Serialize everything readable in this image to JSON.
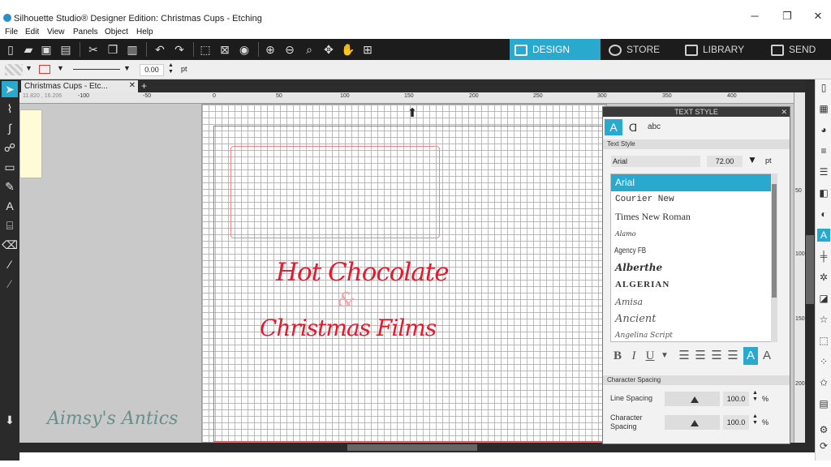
{
  "window": {
    "title": "Silhouette Studio® Designer Edition: Christmas Cups - Etching",
    "minimize": "─",
    "restore": "❐",
    "close": "✕"
  },
  "menu": [
    "File",
    "Edit",
    "View",
    "Panels",
    "Object",
    "Help"
  ],
  "nav_tabs": [
    {
      "label": "DESIGN",
      "active": true
    },
    {
      "label": "STORE",
      "active": false
    },
    {
      "label": "LIBRARY",
      "active": false
    },
    {
      "label": "SEND",
      "active": false
    }
  ],
  "subtoolbar": {
    "line_width": "0.00",
    "unit": "pt"
  },
  "document_tab": {
    "label": "Christmas Cups - Etc...",
    "close": "✕",
    "add": "+"
  },
  "ruler": {
    "coords": "11.820 , 16.206",
    "ticks": [
      "-100",
      "-50",
      "0",
      "50",
      "100",
      "150",
      "200",
      "250",
      "300",
      "350",
      "400"
    ]
  },
  "vruler": {
    "ticks": [
      "50",
      "100",
      "150",
      "200"
    ]
  },
  "canvas_text": {
    "line1": "Hot Chocolate",
    "amp": "&",
    "line2": "Christmas Films"
  },
  "watermark": "Aimsy's Antics",
  "text_style_panel": {
    "header": "TEXT STYLE",
    "close": "✕",
    "section_text_style": "Text Style",
    "font": "Arial",
    "size": "72.00",
    "size_unit": "pt",
    "fonts": [
      "Arial",
      "Courier New",
      "Times New Roman",
      "Alamo",
      "Agency FB",
      "Alberthe",
      "ALGERIAN",
      "Amisa",
      "Ancient",
      "Angelina Script"
    ],
    "section_spacing": "Character Spacing",
    "line_spacing_label": "Line Spacing",
    "line_spacing_value": "100.0",
    "char_spacing_label": "Character Spacing",
    "char_spacing_value": "100.0",
    "percent": "%"
  },
  "colors": {
    "accent": "#2aa9cf",
    "text_red": "#e8192c",
    "toolbar": "#1c1c1c"
  }
}
